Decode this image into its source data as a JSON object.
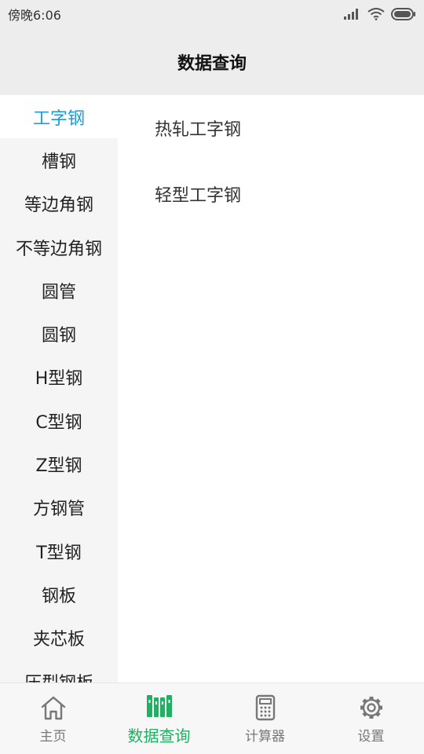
{
  "status_bar": {
    "time": "傍晚6:06"
  },
  "header": {
    "title": "数据查询"
  },
  "sidebar": {
    "items": [
      {
        "label": "工字钢",
        "active": true
      },
      {
        "label": "槽钢"
      },
      {
        "label": "等边角钢"
      },
      {
        "label": "不等边角钢"
      },
      {
        "label": "圆管"
      },
      {
        "label": "圆钢"
      },
      {
        "label": "H型钢"
      },
      {
        "label": "C型钢"
      },
      {
        "label": "Z型钢"
      },
      {
        "label": "方钢管"
      },
      {
        "label": "T型钢"
      },
      {
        "label": "钢板"
      },
      {
        "label": "夹芯板"
      },
      {
        "label": "压型钢板"
      }
    ]
  },
  "content": {
    "items": [
      {
        "label": "热轧工字钢"
      },
      {
        "label": "轻型工字钢"
      }
    ]
  },
  "tabbar": {
    "tabs": [
      {
        "label": "主页",
        "icon": "home-icon"
      },
      {
        "label": "数据查询",
        "icon": "books-icon",
        "active": true
      },
      {
        "label": "计算器",
        "icon": "calculator-icon"
      },
      {
        "label": "设置",
        "icon": "gear-icon"
      }
    ]
  },
  "colors": {
    "accent_blue": "#1e9bd6",
    "accent_green": "#1fb063"
  }
}
